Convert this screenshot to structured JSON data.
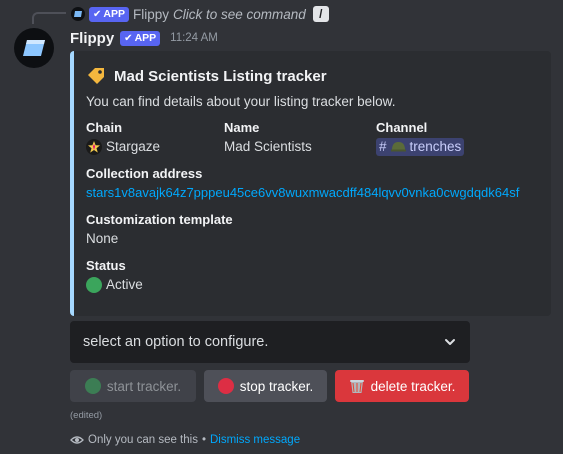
{
  "reply": {
    "bot_name": "Flippy",
    "app_badge": "APP",
    "command_hint": "Click to see command",
    "slash_glyph": "/"
  },
  "message": {
    "username": "Flippy",
    "app_badge": "APP",
    "timestamp": "11:24 AM",
    "edited": "(edited)"
  },
  "embed": {
    "accent_color": "#a5d8ff",
    "title_icon": "label-tag-icon",
    "title": "Mad Scientists Listing tracker",
    "description": "You can find details about your listing tracker below.",
    "fields": {
      "chain": {
        "name": "Chain",
        "value": "Stargaze",
        "icon": "stargaze-star-icon"
      },
      "name": {
        "name": "Name",
        "value": "Mad Scientists"
      },
      "channel": {
        "name": "Channel",
        "hash": "#",
        "value": "trenches",
        "icon": "helmet-icon"
      },
      "collection_address": {
        "name": "Collection address",
        "value": "stars1v8avajk64z7pppeu45ce6vv8wuxmwacdff484lqvv0vnka0cwgdqdk64sf"
      },
      "customization_template": {
        "name": "Customization template",
        "value": "None"
      },
      "status": {
        "name": "Status",
        "value": "Active",
        "dot_color": "#3ba55c"
      }
    }
  },
  "select": {
    "placeholder": "select an option to configure."
  },
  "buttons": {
    "start": {
      "label": "start tracker.",
      "dot_color": "#3ba55c"
    },
    "stop": {
      "label": "stop tracker.",
      "dot_color": "#dd2e44"
    },
    "delete": {
      "label": "delete tracker.",
      "icon": "wastebasket-icon"
    }
  },
  "ephemeral": {
    "notice": "Only you can see this",
    "separator": "•",
    "dismiss": "Dismiss message"
  },
  "colors": {
    "background": "#313338",
    "embed_bg": "#2b2d31",
    "brand": "#5865f2",
    "danger": "#da373c",
    "link": "#00a8fc"
  }
}
